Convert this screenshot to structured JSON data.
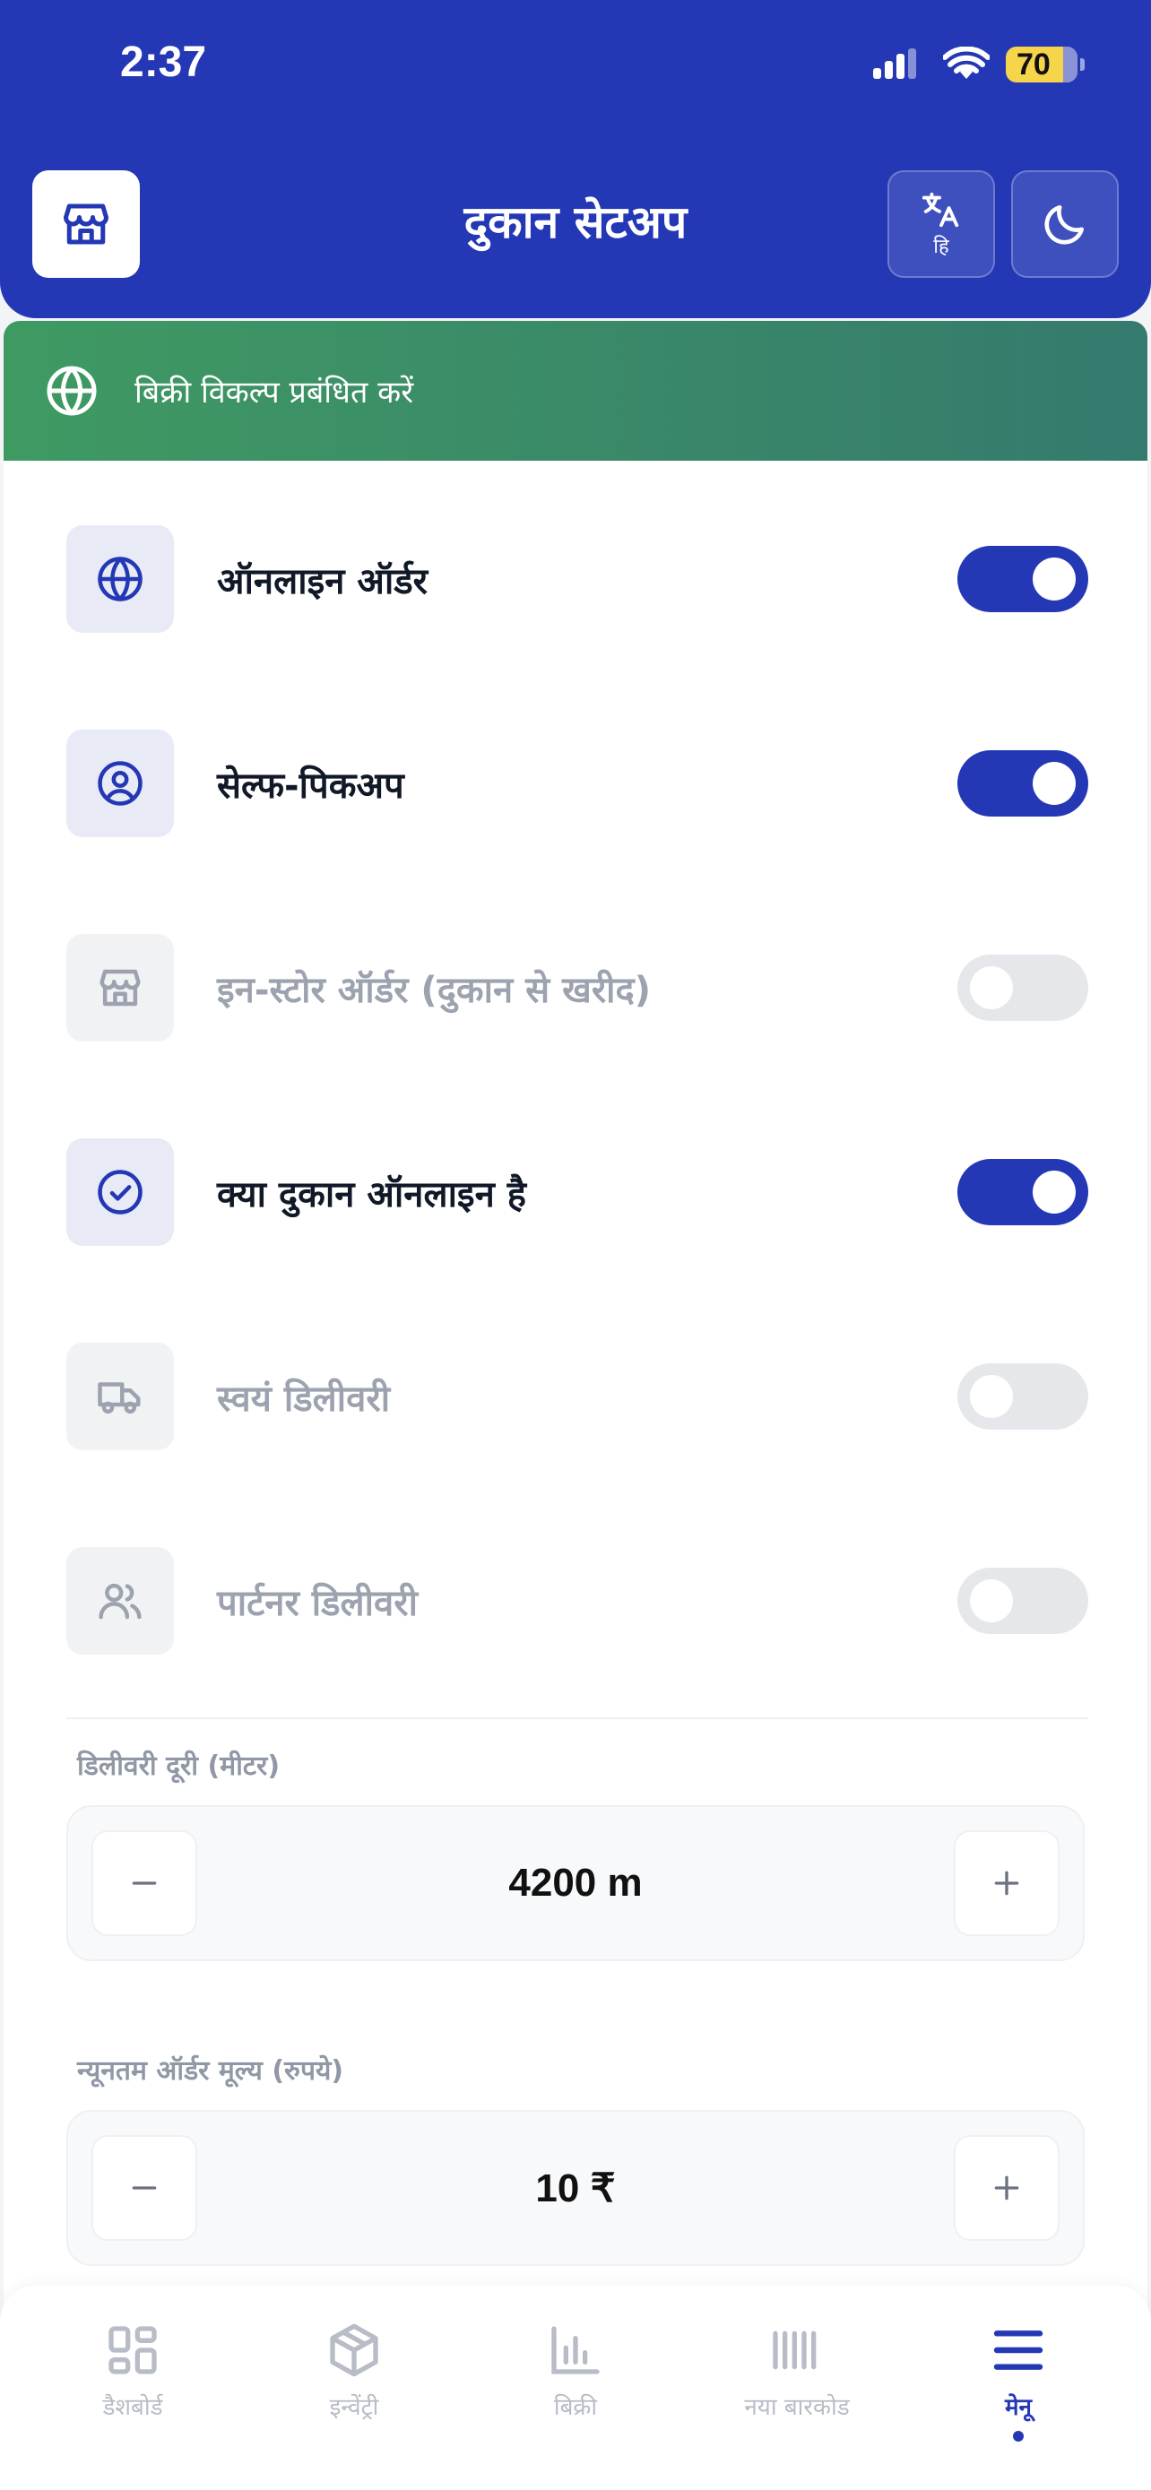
{
  "status_bar": {
    "time": "2:37",
    "battery": "70"
  },
  "header": {
    "title": "दुकान सेटअप",
    "lang_sub": "हि",
    "icons": {
      "store": "store-icon",
      "translate": "translate-icon",
      "theme": "moon-icon"
    }
  },
  "banner": {
    "text": "बिक्री विकल्प प्रबंधित करें",
    "icon": "globe-icon"
  },
  "options": [
    {
      "label": "ऑनलाइन ऑर्डर",
      "icon": "globe-icon",
      "enabled": true
    },
    {
      "label": "सेल्फ-पिकअप",
      "icon": "user-circle-icon",
      "enabled": true
    },
    {
      "label": "इन-स्टोर ऑर्डर (दुकान से खरीद)",
      "icon": "store-icon",
      "enabled": false
    },
    {
      "label": "क्या दुकान ऑनलाइन है",
      "icon": "check-circle-icon",
      "enabled": true
    },
    {
      "label": "स्वयं डिलीवरी",
      "icon": "truck-icon",
      "enabled": false
    },
    {
      "label": "पार्टनर डिलीवरी",
      "icon": "users-icon",
      "enabled": false
    }
  ],
  "delivery_distance": {
    "label": "डिलीवरी दूरी (मीटर)",
    "value": "4200 m"
  },
  "min_order": {
    "label": "न्यूनतम ऑर्डर मूल्य (रुपये)",
    "value": "10 ₹"
  },
  "nav": {
    "items": [
      {
        "label": "डैशबोर्ड",
        "icon": "dashboard-icon"
      },
      {
        "label": "इन्वेंट्री",
        "icon": "box-icon"
      },
      {
        "label": "बिक्री",
        "icon": "bar-chart-icon"
      },
      {
        "label": "नया बारकोड",
        "icon": "barcode-icon"
      },
      {
        "label": "मेनू",
        "icon": "menu-icon"
      }
    ],
    "active_index": 4
  },
  "colors": {
    "primary": "#2438b5",
    "banner_start": "#3f9a62",
    "banner_end": "#357a6e",
    "battery": "#f6d54a"
  }
}
